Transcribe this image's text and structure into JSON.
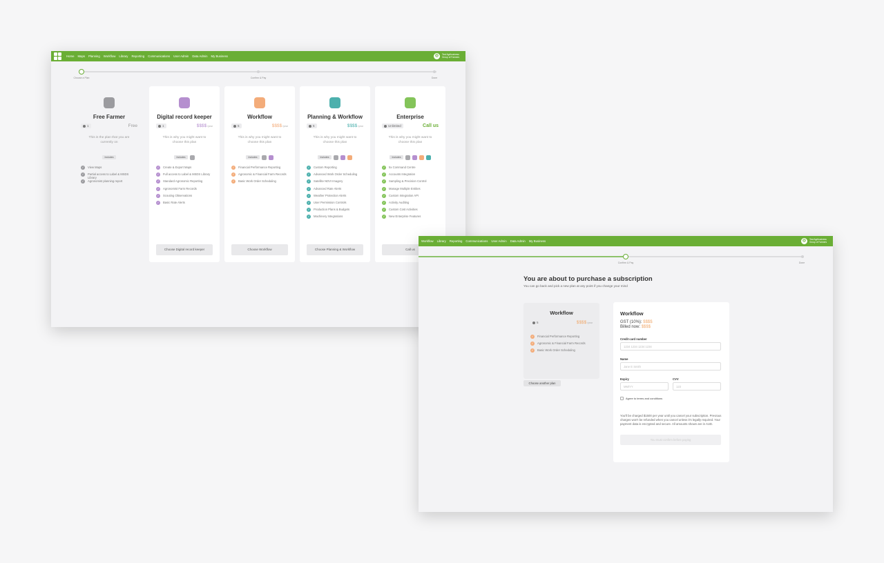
{
  "nav": {
    "links": [
      "Home",
      "Maps",
      "Planning",
      "Workflow",
      "Library",
      "Reporting",
      "Communications",
      "User Admin",
      "Data Admin",
      "My Business"
    ],
    "org_name": "Test Agribusiness Group of Farmers"
  },
  "nav2": {
    "links": [
      "Workflow",
      "Library",
      "Reporting",
      "Communications",
      "User Admin",
      "Data Admin",
      "My Business"
    ],
    "org_name": "Test Agribusiness Group of Farmers"
  },
  "stepper": {
    "steps": [
      "Choose a Plan",
      "Confirm & Pay",
      "Done"
    ]
  },
  "plans": [
    {
      "name": "Free Farmer",
      "color": "#9b9b9f",
      "users": "1",
      "price": "Free",
      "per": "",
      "reason": "This is the plan that you are currently on",
      "includes_label": "Includes",
      "includes_colors": [],
      "check_color": "#9b9b9f",
      "features": [
        "View Maps",
        "Partial access to Label & MSDS Library",
        "Agronomist planning report"
      ],
      "button": ""
    },
    {
      "name": "Digital record keeper",
      "color": "#b58fcf",
      "users": "1",
      "price": "$$$$",
      "per": "/year",
      "reason": "This is why you might want to choose this plan",
      "includes_label": "Includes",
      "includes_colors": [
        "#a9a9ad"
      ],
      "check_color": "#b58fcf",
      "features": [
        "Create & Export Maps",
        "Full access to Label & MSDS Library",
        "Standard Agronomic Reporting",
        "Agronomist Farm Records",
        "Scouting Observations",
        "Basic Rate Alerts"
      ],
      "button": "Choose Digital record keeper"
    },
    {
      "name": "Workflow",
      "color": "#f3ac7a",
      "users": "5",
      "price": "$$$$",
      "per": "/year",
      "reason": "This is why you might want to choose this plan",
      "includes_label": "Includes",
      "includes_colors": [
        "#a9a9ad",
        "#b58fcf"
      ],
      "check_color": "#f3ac7a",
      "features": [
        "Financial Performance Reporting",
        "Agronomic & Financial Farm Records",
        "Basic Work Order Scheduling"
      ],
      "button": "Choose Workflow"
    },
    {
      "name": "Planning & Workflow",
      "color": "#4cb0ad",
      "users": "5",
      "price": "$$$$",
      "per": "/year",
      "reason": "This is why you might want to choose this plan",
      "includes_label": "Includes",
      "includes_colors": [
        "#a9a9ad",
        "#b58fcf",
        "#f3ac7a"
      ],
      "check_color": "#4cb0ad",
      "features": [
        "Custom Reporting",
        "Advanced Work Order Scheduling",
        "Satellite NDVI Imagery",
        "Advanced Rate Alerts",
        "Weather Protection Alerts",
        "User Permission Controls",
        "Production Plans & Budgets",
        "Machinery Integrations"
      ],
      "button": "Choose Planning & Workflow"
    },
    {
      "name": "Enterprise",
      "color": "#84c45a",
      "users": "Unlimited",
      "price": "Call us",
      "per": "",
      "reason": "This is why you might want to choose this plan",
      "includes_label": "Includes",
      "includes_colors": [
        "#a9a9ad",
        "#b58fcf",
        "#f3ac7a",
        "#4cb0ad"
      ],
      "check_color": "#84c45a",
      "features": [
        "5x Command Centre",
        "Accounts Integration",
        "Sampling & Precision Control",
        "Manage Multiple Entities",
        "Custom Integration API",
        "Activity Auditing",
        "Custom Cost Activities",
        "New Enterprise Features"
      ],
      "button": "Call us"
    }
  ],
  "checkout": {
    "title": "You are about to purchase a subscription",
    "subtitle": "You can go back and pick a new plan at any point if you change your mind",
    "summary": {
      "name": "Workflow",
      "users": "5",
      "price": "$$$$",
      "per": "/year",
      "features": [
        "Financial Performance Reporting",
        "Agronomic & Financial Farm Records",
        "Basic Work Order Scheduling"
      ]
    },
    "change_button": "Choose another plan",
    "card": {
      "title": "Workflow",
      "gst_label": "GST (10%):",
      "gst_value": "$$$$",
      "billed_label": "Billed now:",
      "billed_value": "$$$$",
      "cc_label": "Credit card number",
      "cc_placeholder": "1234 1234 1234 1234",
      "name_label": "Name",
      "name_placeholder": "Jane E Smith",
      "expiry_label": "Expiry",
      "expiry_placeholder": "MM/YY",
      "cvv_label": "CVV",
      "cvv_placeholder": "123",
      "agree_label": "Agree to terms and conditions",
      "disclaimer": "You'll be charged $1500 per year until you cancel your subscription. Previous charges won't be refunded when you cancel unless it's legally required. Your payment data is encrypted and secure. All amounts shown are in AUD.",
      "pay_button": "You must confirm before paying"
    }
  }
}
